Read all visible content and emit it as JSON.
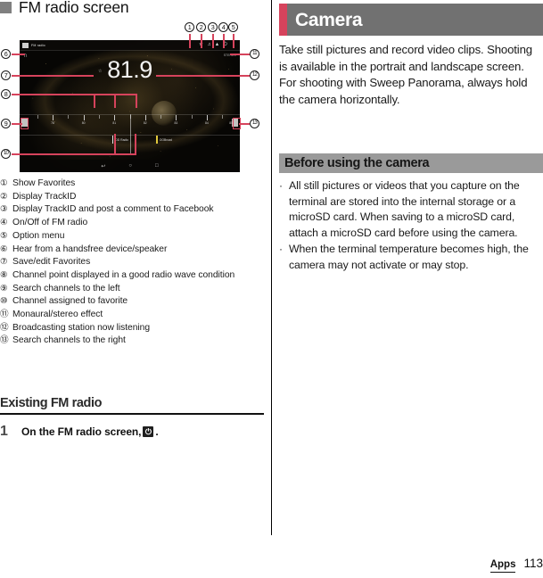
{
  "left": {
    "section_heading": "FM radio screen",
    "figure": {
      "app_title": "FM radio",
      "frequency": "81.9",
      "stereo_label": "STEREO",
      "appbar_icons": [
        "favorites-icon",
        "trackid-icon",
        "facebook-post-icon",
        "power-icon",
        "overflow-menu-icon"
      ],
      "dial_tick_labels": [
        "78",
        "80",
        "81",
        "82",
        "83",
        "84",
        "85"
      ],
      "favorites": [
        {
          "label": "DD Radio",
          "color": "#e8e8e8"
        },
        {
          "label": "OOBroad",
          "color": "#e0c83c"
        }
      ],
      "nav_left_label": "seek-left-button",
      "nav_right_label": "seek-right-button",
      "system_buttons": [
        "back-icon",
        "home-icon",
        "recents-icon"
      ]
    },
    "callouts": [
      "1",
      "2",
      "3",
      "4",
      "5",
      "6",
      "7",
      "8",
      "9",
      "10",
      "11",
      "12",
      "13"
    ],
    "legend": [
      {
        "num": "①",
        "text": "Show Favorites"
      },
      {
        "num": "②",
        "text": "Display TrackID"
      },
      {
        "num": "③",
        "text": "Display TrackID and post a comment to Facebook"
      },
      {
        "num": "④",
        "text": "On/Off of FM radio"
      },
      {
        "num": "⑤",
        "text": "Option menu"
      },
      {
        "num": "⑥",
        "text": "Hear from a handsfree device/speaker"
      },
      {
        "num": "⑦",
        "text": "Save/edit Favorites"
      },
      {
        "num": "⑧",
        "text": "Channel point displayed in a good radio wave condition"
      },
      {
        "num": "⑨",
        "text": "Search channels to the left"
      },
      {
        "num": "⑩",
        "text": "Channel assigned to favorite"
      },
      {
        "num": "⑪",
        "text": "Monaural/stereo effect"
      },
      {
        "num": "⑫",
        "text": "Broadcasting station now listening"
      },
      {
        "num": "⑬",
        "text": "Search channels to the right"
      }
    ],
    "subsection_title": "Existing FM radio",
    "step": {
      "number": "1",
      "text_before": "On the FM radio screen,",
      "icon": "power-icon",
      "text_after": "."
    }
  },
  "right": {
    "chapter_title": "Camera",
    "intro": "Take still pictures and record video clips. Shooting is available in the portrait and landscape screen. For shooting with Sweep Panorama, always hold the camera horizontally.",
    "sub_heading": "Before using the camera",
    "bullets": [
      "All still pictures or videos that you capture on the terminal are stored into the internal storage or a microSD card. When saving to a microSD card, attach a microSD card before using the camera.",
      "When the terminal temperature becomes high, the camera may not activate or may stop."
    ]
  },
  "footer": {
    "tab": "Apps",
    "page_number": "113"
  },
  "colors": {
    "accent_red": "#d6435c",
    "chapter_bg": "#717171",
    "subhead_bg": "#9a9a9a"
  }
}
